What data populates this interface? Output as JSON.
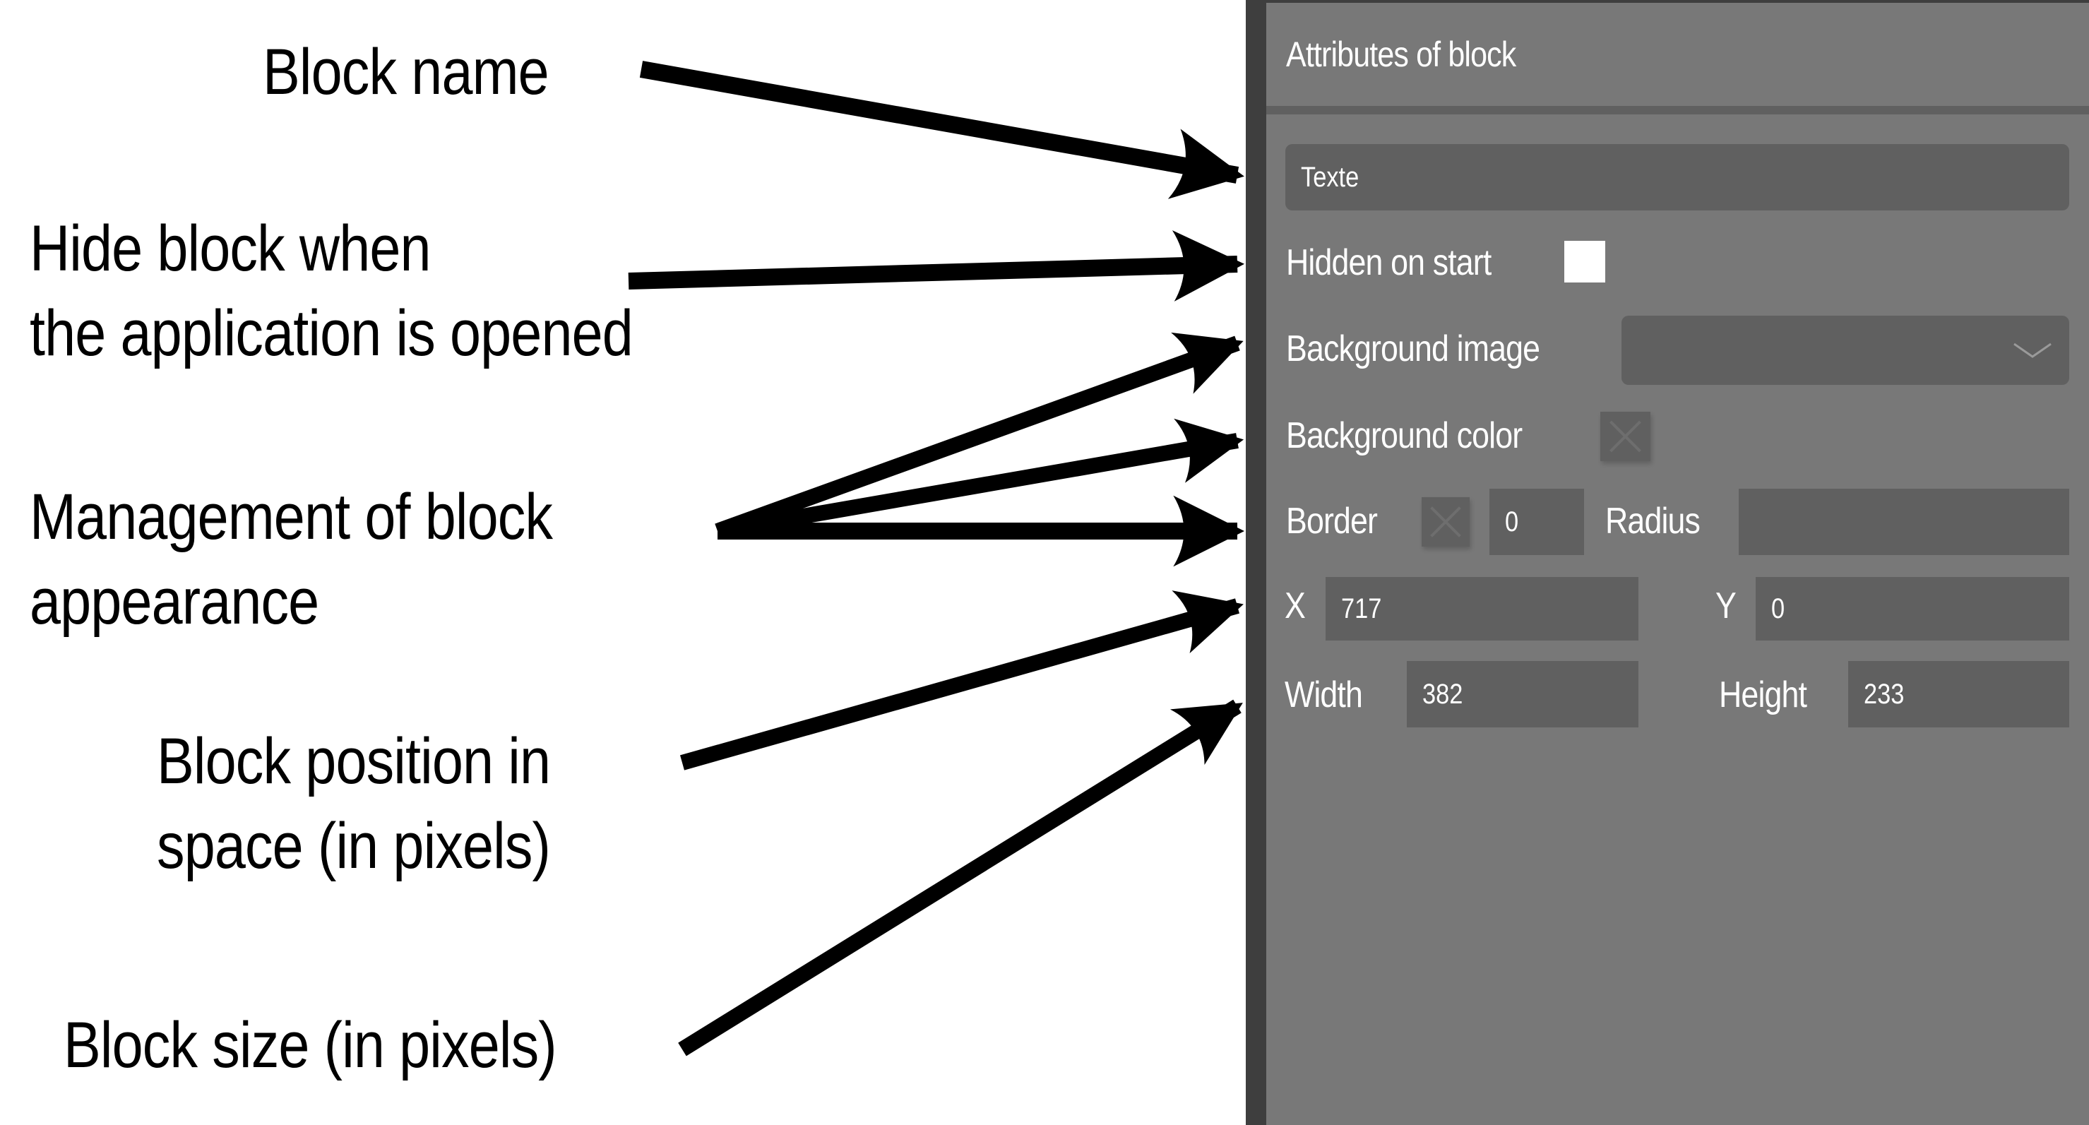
{
  "annotations": {
    "block_name": "Block name",
    "hide_block_line1": "Hide block when",
    "hide_block_line2": "the application is opened",
    "appearance_line1": "Management of block",
    "appearance_line2": "appearance",
    "position_line1": "Block position in",
    "position_line2": "space (in pixels)",
    "size": "Block size (in pixels)"
  },
  "panel": {
    "title": "Attributes of block",
    "block_name_value": "Texte",
    "hidden_on_start": {
      "label": "Hidden on start",
      "checked": false
    },
    "background_image": {
      "label": "Background image",
      "value": "",
      "icon": "chevron-down-icon"
    },
    "background_color": {
      "label": "Background color",
      "value": "none",
      "icon": "x-icon"
    },
    "border": {
      "label": "Border",
      "color": "none",
      "icon": "x-icon",
      "width": "0"
    },
    "radius": {
      "label": "Radius",
      "value": ""
    },
    "x": {
      "label": "X",
      "value": "717"
    },
    "y": {
      "label": "Y",
      "value": "0"
    },
    "width": {
      "label": "Width",
      "value": "382"
    },
    "height": {
      "label": "Height",
      "value": "233"
    }
  },
  "colors": {
    "panel_bg": "#787878",
    "field_bg": "#606060",
    "panel_border": "#3e3e3e",
    "text": "#ffffff",
    "annotation_text": "#000000"
  }
}
